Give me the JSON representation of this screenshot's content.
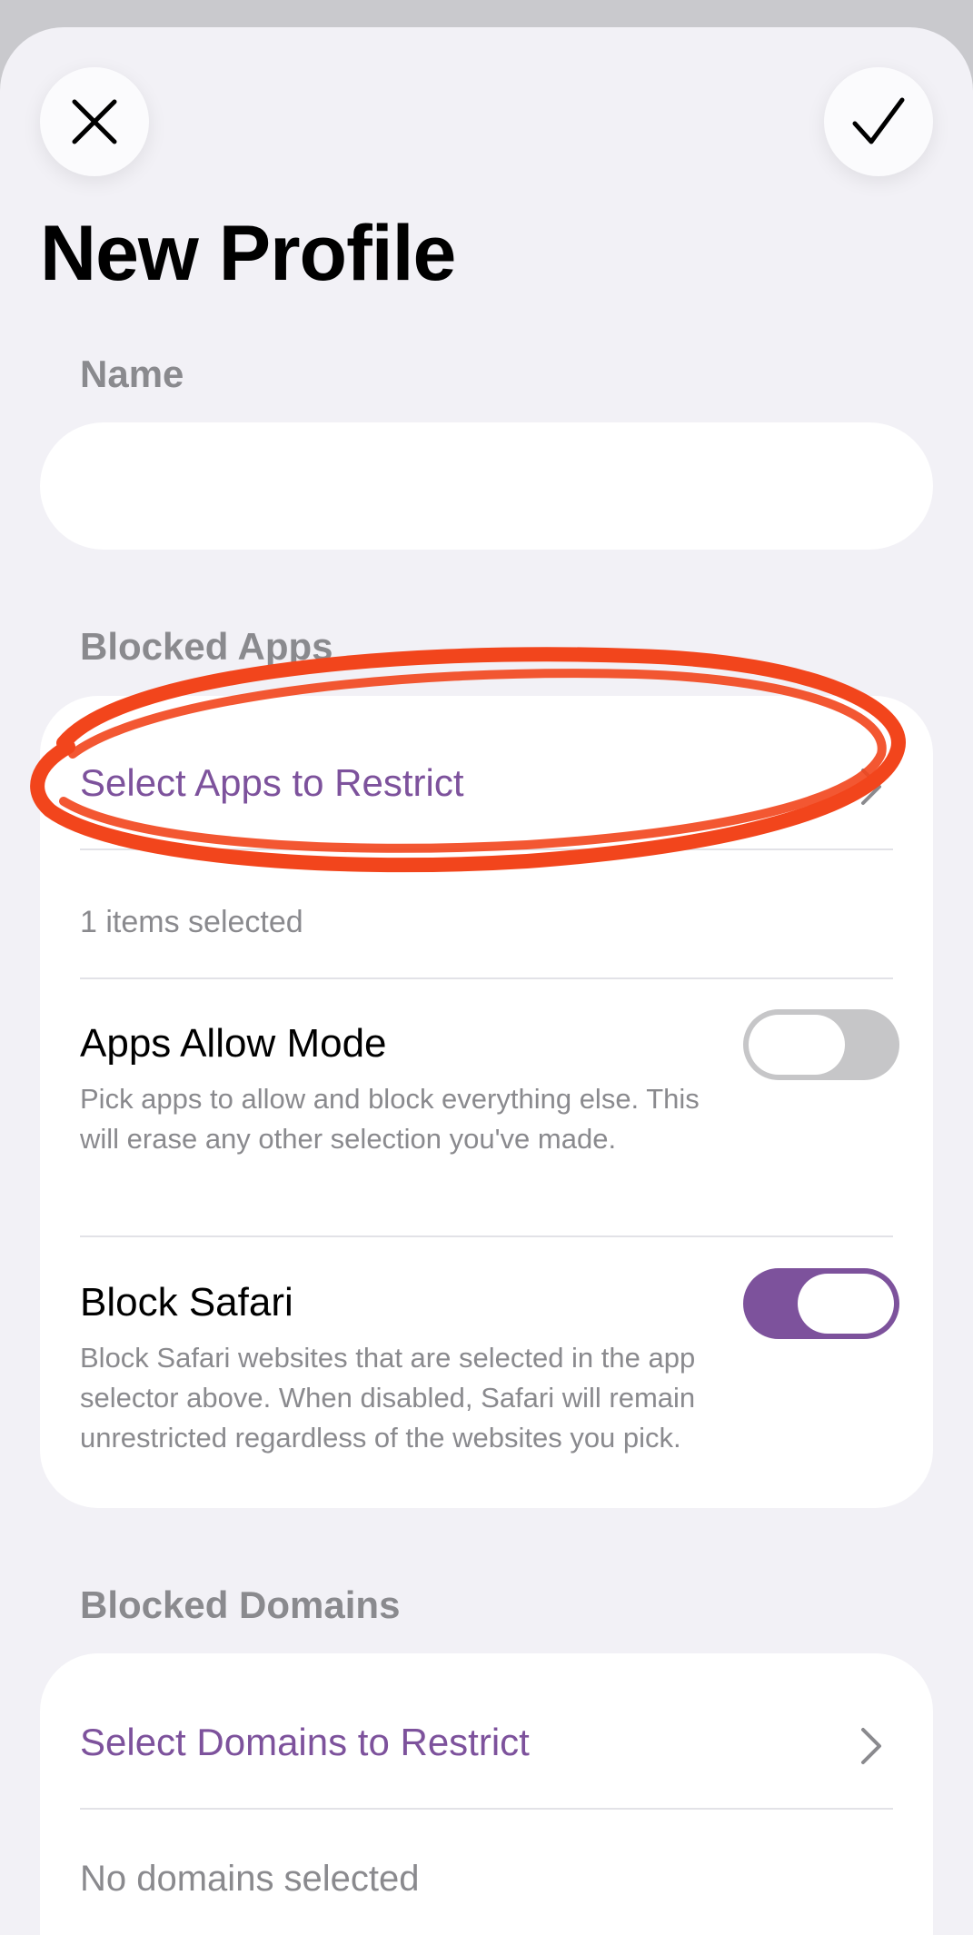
{
  "header": {
    "close_icon": "close-icon",
    "confirm_icon": "checkmark-icon",
    "title": "New Profile"
  },
  "name_section": {
    "label": "Name",
    "value": "",
    "placeholder": ""
  },
  "blocked_apps": {
    "label": "Blocked Apps",
    "select_label": "Select Apps to Restrict",
    "chevron_icon": "chevron-right-icon",
    "selected_summary": "1 items selected",
    "allow_mode": {
      "title": "Apps Allow Mode",
      "description": "Pick apps to allow and block everything else. This will erase any other selection you've made.",
      "enabled": false
    },
    "block_safari": {
      "title": "Block Safari",
      "description": "Block Safari websites that are selected in the app selector above. When disabled, Safari will remain unrestricted regardless of the websites you pick.",
      "enabled": true
    }
  },
  "blocked_domains": {
    "label": "Blocked Domains",
    "select_label": "Select Domains to Restrict",
    "chevron_icon": "chevron-right-icon",
    "selected_summary": "No domains selected"
  },
  "annotation": {
    "shape": "hand-drawn-ellipse",
    "color": "#f2451c"
  },
  "colors": {
    "accent": "#7d529c",
    "background": "#f2f1f6",
    "card": "#ffffff",
    "secondary_text": "#8a8a8e",
    "toggle_off": "#c6c6c8"
  }
}
